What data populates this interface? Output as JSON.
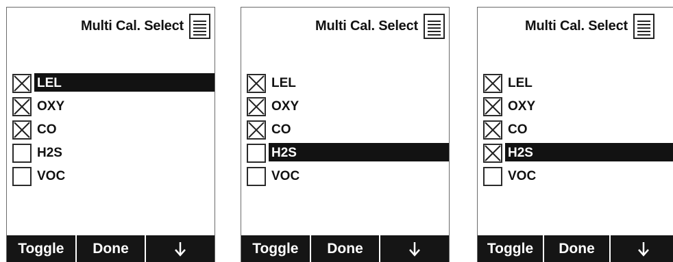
{
  "colors": {
    "screen_bg": "#ffffff",
    "highlight_bg": "#121212",
    "softkey_bg": "#151515"
  },
  "screens": [
    {
      "title": "Multi Cal. Select",
      "items": [
        {
          "label": "LEL",
          "checked": true,
          "selected": true
        },
        {
          "label": "OXY",
          "checked": true,
          "selected": false
        },
        {
          "label": "CO",
          "checked": true,
          "selected": false
        },
        {
          "label": "H2S",
          "checked": false,
          "selected": false
        },
        {
          "label": "VOC",
          "checked": false,
          "selected": false
        }
      ],
      "softkeys": {
        "left": "Toggle",
        "middle": "Done",
        "right_icon": "arrow-down-icon"
      }
    },
    {
      "title": "Multi Cal. Select",
      "items": [
        {
          "label": "LEL",
          "checked": true,
          "selected": false
        },
        {
          "label": "OXY",
          "checked": true,
          "selected": false
        },
        {
          "label": "CO",
          "checked": true,
          "selected": false
        },
        {
          "label": "H2S",
          "checked": false,
          "selected": true
        },
        {
          "label": "VOC",
          "checked": false,
          "selected": false
        }
      ],
      "softkeys": {
        "left": "Toggle",
        "middle": "Done",
        "right_icon": "arrow-down-icon"
      }
    },
    {
      "title": "Multi Cal. Select",
      "items": [
        {
          "label": "LEL",
          "checked": true,
          "selected": false
        },
        {
          "label": "OXY",
          "checked": true,
          "selected": false
        },
        {
          "label": "CO",
          "checked": true,
          "selected": false
        },
        {
          "label": "H2S",
          "checked": true,
          "selected": true
        },
        {
          "label": "VOC",
          "checked": false,
          "selected": false
        }
      ],
      "softkeys": {
        "left": "Toggle",
        "middle": "Done",
        "right_icon": "arrow-down-icon"
      }
    }
  ]
}
